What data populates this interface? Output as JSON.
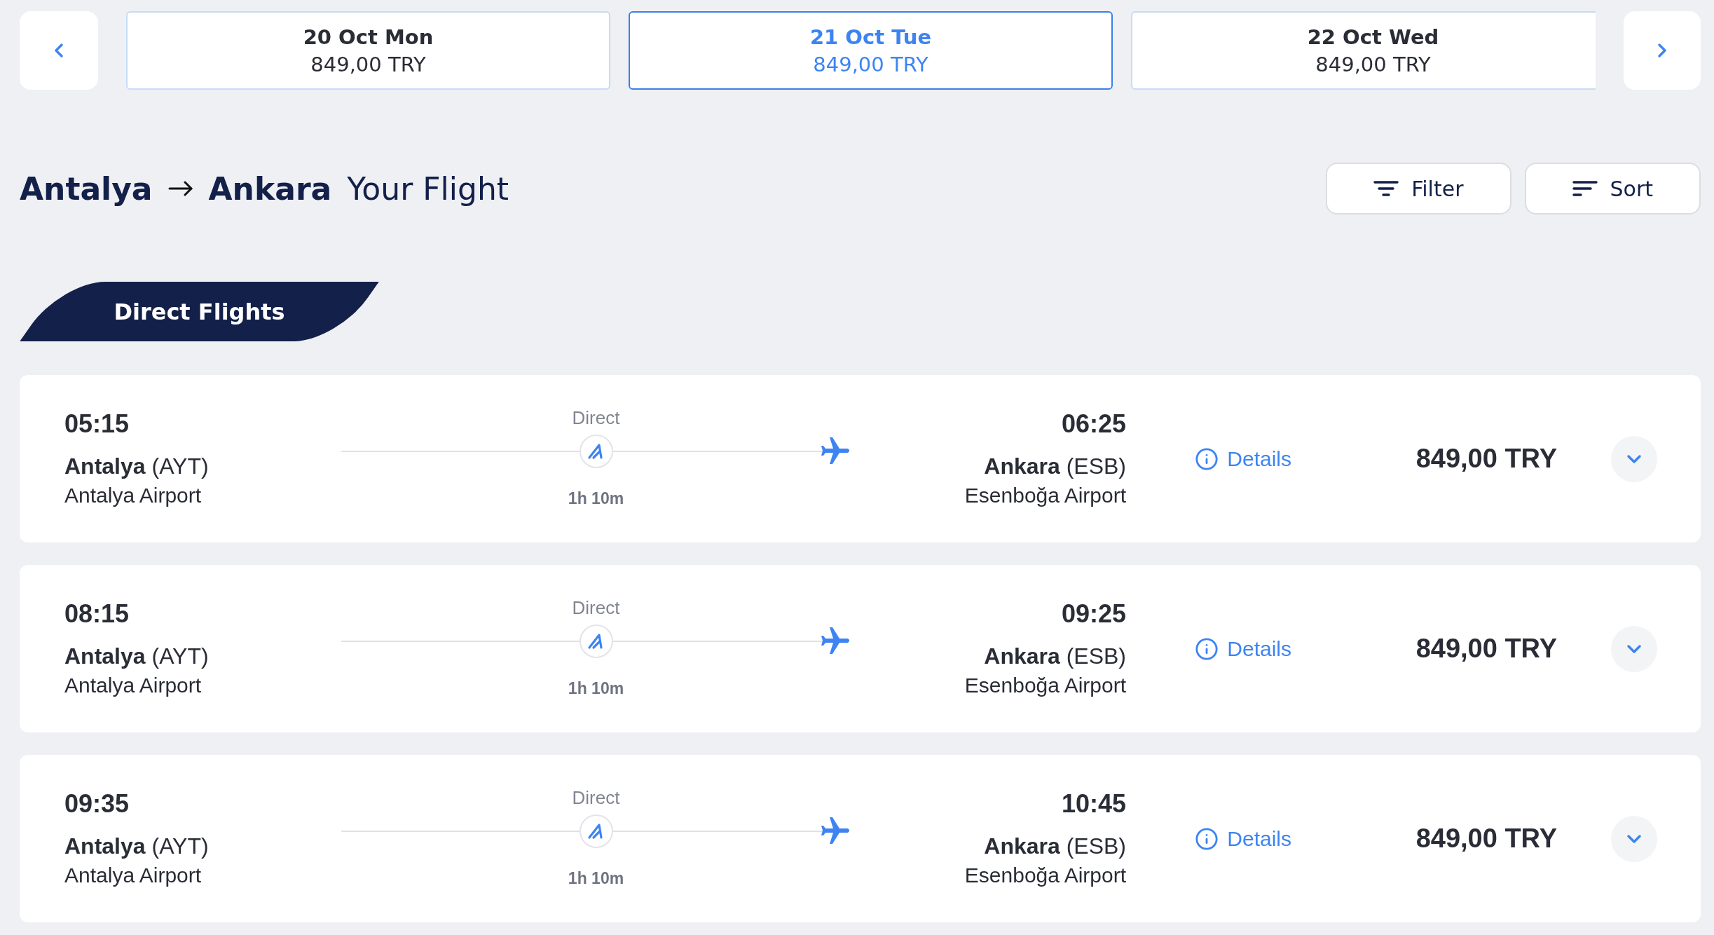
{
  "date_nav": {
    "days": [
      {
        "label": "20 Oct Mon",
        "price": "849,00 TRY",
        "selected": false
      },
      {
        "label": "21 Oct Tue",
        "price": "849,00 TRY",
        "selected": true
      },
      {
        "label": "22 Oct Wed",
        "price": "849,00 TRY",
        "selected": false
      }
    ]
  },
  "title": {
    "origin": "Antalya",
    "destination": "Ankara",
    "subtitle": "Your Flight"
  },
  "toolbar": {
    "buttons": [
      {
        "kind": "filter",
        "label": "Filter"
      },
      {
        "kind": "sort",
        "label": "Sort"
      }
    ]
  },
  "tabs": [
    {
      "label": "Direct Flights",
      "selected": true
    }
  ],
  "flights": [
    {
      "departure": {
        "time": "05:15",
        "city": "**Antalya** (AYT)",
        "airport": "Antalya Airport"
      },
      "stops": "Direct",
      "duration": "1h 10m",
      "arrival": {
        "time": "06:25",
        "city": "**Ankara** (ESB)",
        "airport": "Esenboğa Airport"
      },
      "details": "Details",
      "price": "849,00 TRY",
      "expanded": false
    },
    {
      "departure": {
        "time": "08:15",
        "city": "**Antalya** (AYT)",
        "airport": "Antalya Airport"
      },
      "stops": "Direct",
      "duration": "1h 10m",
      "arrival": {
        "time": "09:25",
        "city": "**Ankara** (ESB)",
        "airport": "Esenboğa Airport"
      },
      "details": "Details",
      "price": "849,00 TRY",
      "expanded": false
    },
    {
      "departure": {
        "time": "09:35",
        "city": "**Antalya** (AYT)",
        "airport": "Antalya Airport"
      },
      "stops": "Direct",
      "duration": "1h 10m",
      "arrival": {
        "time": "10:45",
        "city": "**Ankara** (ESB)",
        "airport": "Esenboğa Airport"
      },
      "details": "Details",
      "price": "849,00 TRY",
      "expanded": false
    }
  ]
}
